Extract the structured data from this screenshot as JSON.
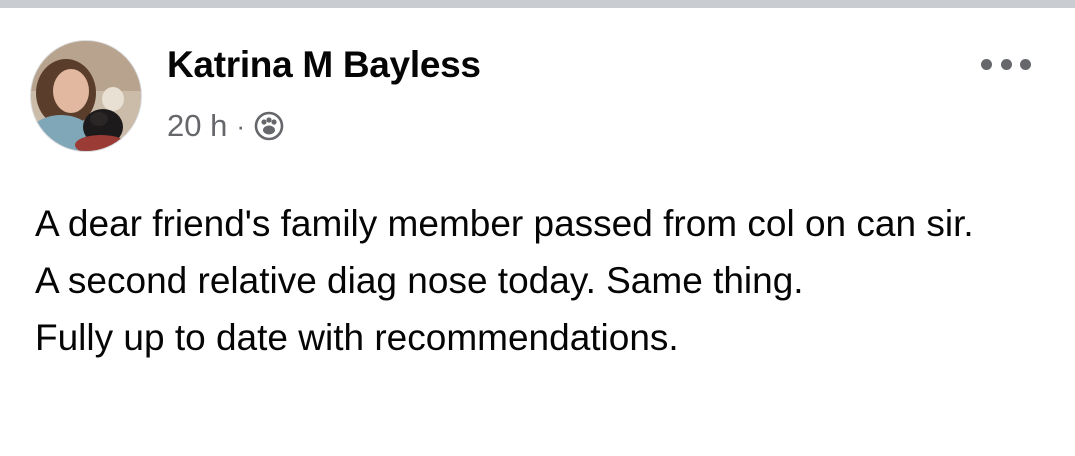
{
  "post": {
    "author": {
      "name": "Katrina M Bayless",
      "avatar_icon": "profile-photo"
    },
    "timestamp": "20 h",
    "separator": "·",
    "audience_icon": "friends-icon",
    "more_icon": "more-options-icon",
    "body_lines": [
      "A dear friend's family member passed from col on can sir.",
      "A second relative diag nose today. Same thing.",
      "Fully up to date with recommendations."
    ]
  },
  "colors": {
    "top_bar": "#c9ccd1",
    "name_text": "#050505",
    "meta_text": "#65676b",
    "body_text": "#050505"
  }
}
